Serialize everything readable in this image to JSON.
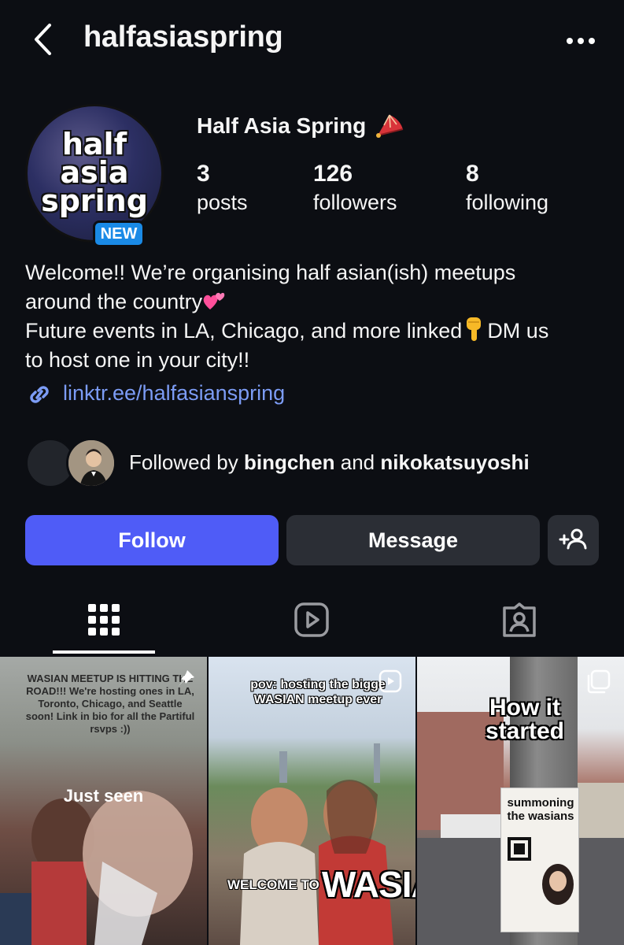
{
  "header": {
    "username": "halfasiaspring"
  },
  "profile": {
    "avatar_text_lines": [
      "half",
      "asia",
      "spring"
    ],
    "new_badge": "NEW",
    "display_name": "Half Asia Spring",
    "stats": [
      {
        "value": "3",
        "label": "posts"
      },
      {
        "value": "126",
        "label": "followers"
      },
      {
        "value": "8",
        "label": "following"
      }
    ],
    "bio": {
      "line1": "Welcome!! We’re organising half asian(ish) meetups",
      "line2": "around the country",
      "line3a": "Future events in LA, Chicago, and more linked",
      "line3b": "DM us",
      "line4": "to host one in your city!!"
    },
    "link": "linktr.ee/halfasianspring",
    "followed_by": {
      "prefix": "Followed by",
      "user1": "bingchen",
      "conj": "and",
      "user2": "nikokatsuyoshi"
    }
  },
  "actions": {
    "follow": "Follow",
    "message": "Message"
  },
  "grid": {
    "post1": {
      "caption": "WASIAN MEETUP IS HITTING THE ROAD!!! We're hosting ones in LA, Toronto, Chicago, and Seattle soon! Link in bio for all the Partiful rsvps :))",
      "overlay": "Just seen"
    },
    "post2": {
      "caption": "pov: hosting the bigge WASIAN meetup ever",
      "welcome": "WELCOME TO",
      "big": "WASIA"
    },
    "post3": {
      "title": "How it started",
      "poster": "summoning the wasians"
    }
  },
  "colors": {
    "accent": "#4f5cf7",
    "link": "#7c9cf5",
    "badge": "#1a8ae6",
    "background": "#0c0e13"
  }
}
